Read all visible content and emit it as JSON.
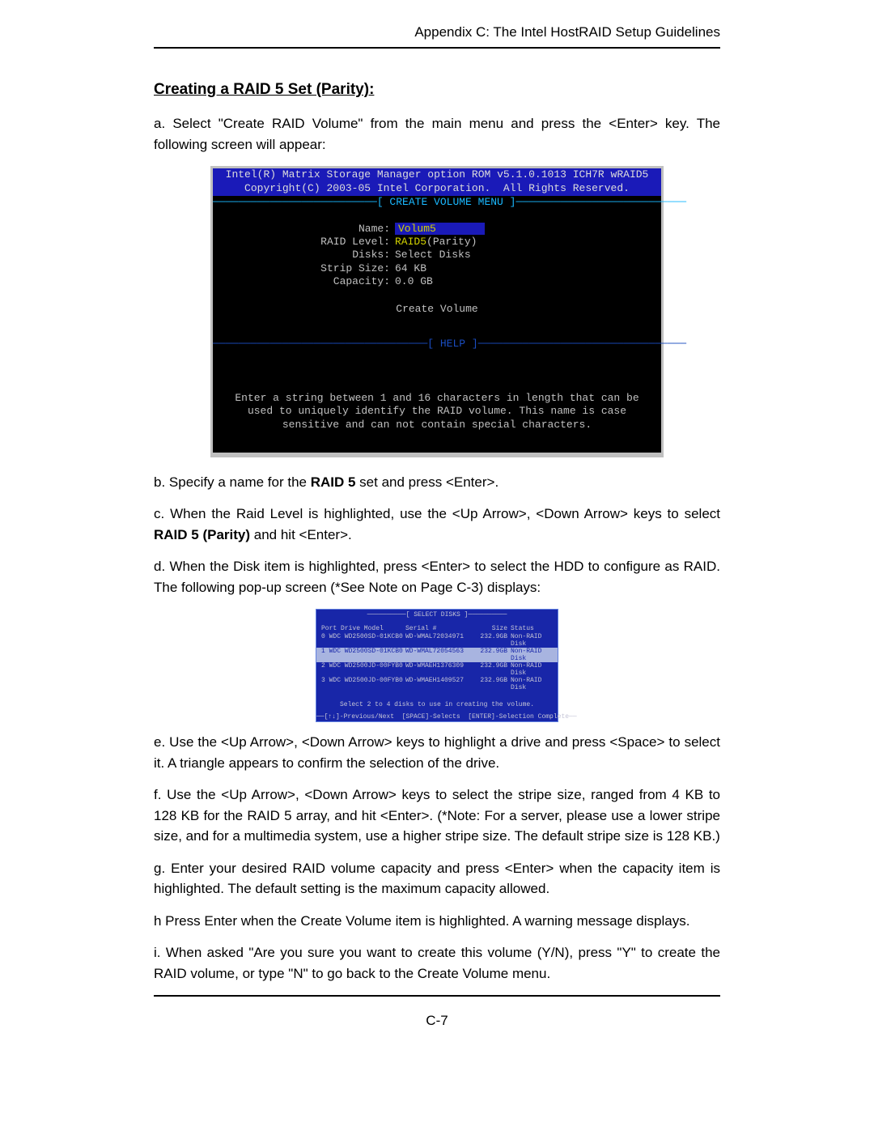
{
  "header": "Appendix C: The Intel HostRAID Setup Guidelines",
  "section_title": "Creating a RAID 5 Set (Parity):",
  "intro": "a. Select \"Create RAID Volume\" from the main menu and press the <Enter> key. The following screen will appear:",
  "bios": {
    "title1": "Intel(R) Matrix Storage Manager option ROM v5.1.0.1013 ICH7R wRAID5",
    "title2": "Copyright(C) 2003-05 Intel Corporation.  All Rights Reserved.",
    "menu_tag": "──────────────────────────[ CREATE VOLUME MENU ]───────────────────────────",
    "name_lbl": "Name:",
    "name_val": "Volum5",
    "raid_lbl": "RAID Level:",
    "raid_val_hl": "RAID5",
    "raid_val_rest": "(Parity)",
    "disks_lbl": "Disks:",
    "disks_val": "Select Disks",
    "strip_lbl": "Strip Size:",
    "strip_val": "64  KB",
    "cap_lbl": "Capacity:",
    "cap_val": "0.0   GB",
    "create": "Create Volume",
    "help_tag": "──────────────────────────────────[ HELP ]─────────────────────────────────",
    "help_text": "Enter a string between 1 and 16 characters in length that can be used to uniquely identify the RAID volume. This name is case sensitive and can not contain special characters."
  },
  "step_b_pre": "b. Specify a name for the ",
  "step_b_bold": "RAID 5",
  "step_b_post": " set and press <Enter>.",
  "step_c_pre": "c. When the Raid Level is highlighted, use the <Up Arrow>, <Down Arrow> keys to select  ",
  "step_c_bold": "RAID 5 (Parity)",
  "step_c_post": " and hit <Enter>.",
  "step_d": "d. When the Disk item is highlighted, press <Enter> to select the HDD to configure as RAID.  The following pop-up screen (*See Note on Page C-3) displays:",
  "select": {
    "title": "──────────[ SELECT DISKS ]──────────",
    "hdr": {
      "c1": "Port Drive Model",
      "c2": "Serial #",
      "c3": "Size",
      "c4": "Status"
    },
    "rows": [
      {
        "c1": "0 WDC WD2500SD-01KCB0",
        "c2": "WD-WMAL72034971",
        "c3": "232.9GB",
        "c4": "Non-RAID Disk",
        "hl": false
      },
      {
        "c1": "1 WDC WD2500SD-01KCB0",
        "c2": "WD-WMAL72054563",
        "c3": "232.9GB",
        "c4": "Non-RAID Disk",
        "hl": true
      },
      {
        "c1": "2 WDC WD2500JD-00FYB0",
        "c2": "WD-WMAEH1376309",
        "c3": "232.9GB",
        "c4": "Non-RAID Disk",
        "hl": false
      },
      {
        "c1": "3 WDC WD2500JD-00FYB0",
        "c2": "WD-WMAEH1409527",
        "c3": "232.9GB",
        "c4": "Non-RAID Disk",
        "hl": false
      }
    ],
    "tip": "Select 2 to 4 disks to use in creating the volume.",
    "foot": "──[↑↓]-Previous/Next  [SPACE]-Selects  [ENTER]-Selection Complete──"
  },
  "step_e": "e. Use  the <Up Arrow>, <Down Arrow> keys to highlight a drive and press <Space> to select it. A triangle appears to confirm the selection of the drive.",
  "step_f": "f. Use  the <Up Arrow>, <Down Arrow> keys to select the stripe size, ranged from 4 KB to 128 KB for the RAID 5 array, and hit <Enter>. (*Note: For a server, please use a lower stripe size, and for a multimedia system, use a higher stripe size. The default stripe size is 128 KB.)",
  "step_g": "g. Enter your desired RAID volume capacity and press <Enter> when the capacity item is highlighted. The default setting is the maximum capacity allowed.",
  "step_h": "h  Press Enter when the Create Volume item is highlighted. A warning message displays.",
  "step_i": "i. When asked \"Are you sure you want to create this volume (Y/N), press \"Y\" to create the RAID volume, or type \"N\" to go back to the Create Volume menu.",
  "page_number": "C-7"
}
